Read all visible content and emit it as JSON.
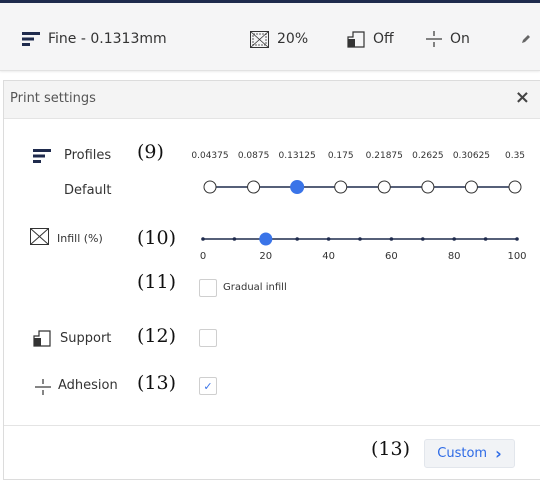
{
  "topbar": {
    "profile_label": "Fine - 0.1313mm",
    "infill_label": "20%",
    "support_label": "Off",
    "adhesion_label": "On"
  },
  "panel": {
    "title": "Print settings",
    "close_glyph": "×",
    "profiles": {
      "label": "Profiles",
      "marker": "(9)",
      "sublabel": "Default",
      "ticks": [
        "0.04375",
        "0.0875",
        "0.13125",
        "0.175",
        "0.21875",
        "0.2625",
        "0.30625",
        "0.35"
      ],
      "selected_index": 2
    },
    "infill": {
      "label": "Infill (%)",
      "marker": "(10)",
      "ticks": [
        "0",
        "20",
        "40",
        "60",
        "80",
        "100"
      ],
      "value": 20,
      "min": 0,
      "max": 100
    },
    "gradual": {
      "marker": "(11)",
      "label": "Gradual infill",
      "checked": false
    },
    "support": {
      "label": "Support",
      "marker": "(12)",
      "checked": false
    },
    "adhesion": {
      "label": "Adhesion",
      "marker": "(13)",
      "checked": true,
      "check_glyph": "✓"
    },
    "footer": {
      "marker": "(13)",
      "custom_label": "Custom",
      "custom_chevron": "›"
    }
  },
  "colors": {
    "accent": "#3a74e8",
    "topbar_border": "#1f2b4d",
    "custom_text": "#2e6be6"
  },
  "icons": {
    "profile": "layer-lines-icon",
    "infill": "infill-cross-icon",
    "support": "support-icon",
    "adhesion": "adhesion-icon",
    "edit": "pencil-icon"
  }
}
